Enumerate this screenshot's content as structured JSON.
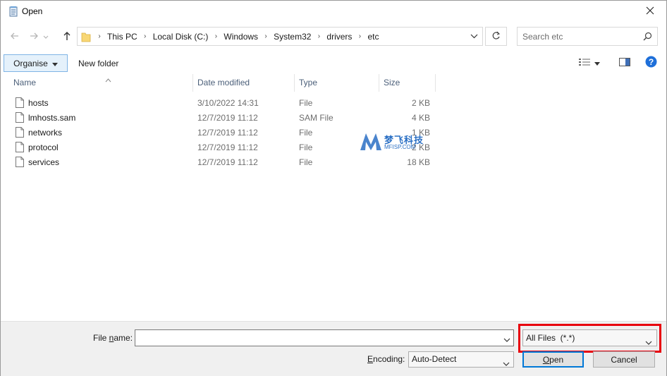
{
  "window": {
    "title": "Open"
  },
  "address": {
    "crumbs": [
      "This PC",
      "Local Disk (C:)",
      "Windows",
      "System32",
      "drivers",
      "etc"
    ]
  },
  "search": {
    "placeholder": "Search etc"
  },
  "toolbar": {
    "organise_label": "Organise",
    "new_folder_label": "New folder"
  },
  "columns": {
    "name": "Name",
    "date": "Date modified",
    "type": "Type",
    "size": "Size"
  },
  "files": [
    {
      "name": "hosts",
      "date": "3/10/2022 14:31",
      "type": "File",
      "size": "2 KB"
    },
    {
      "name": "lmhosts.sam",
      "date": "12/7/2019 11:12",
      "type": "SAM File",
      "size": "4 KB"
    },
    {
      "name": "networks",
      "date": "12/7/2019 11:12",
      "type": "File",
      "size": "1 KB"
    },
    {
      "name": "protocol",
      "date": "12/7/2019 11:12",
      "type": "File",
      "size": "2 KB"
    },
    {
      "name": "services",
      "date": "12/7/2019 11:12",
      "type": "File",
      "size": "18 KB"
    }
  ],
  "watermark": {
    "text": "梦飞科技",
    "sub": "MFISP.COM"
  },
  "bottom": {
    "file_name_label_pre": "File ",
    "file_name_label_ul": "n",
    "file_name_label_post": "ame:",
    "file_name_value": "",
    "filter_value": "All Files  (*.*)",
    "encoding_label_ul": "E",
    "encoding_label_post": "ncoding:",
    "encoding_value": "Auto-Detect",
    "open_label_ul": "O",
    "open_label_post": "pen",
    "cancel_label": "Cancel"
  },
  "colors": {
    "highlight": "#e8000d",
    "accent": "#0078d7",
    "organise_bg": "#e5f1fb"
  }
}
